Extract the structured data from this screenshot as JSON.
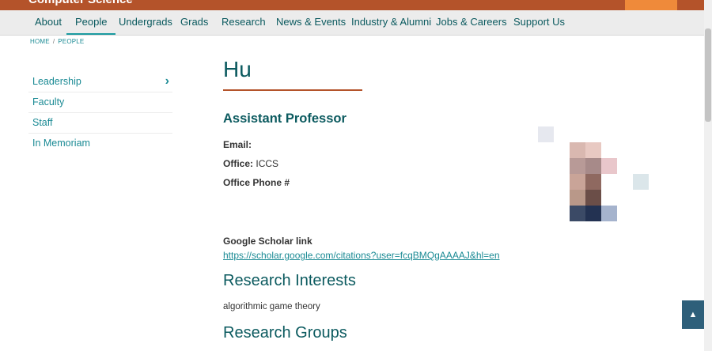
{
  "header": {
    "site_title": "Computer Science"
  },
  "nav": {
    "items": [
      {
        "label": "About"
      },
      {
        "label": "People"
      },
      {
        "label": "Undergrads"
      },
      {
        "label": "Grads"
      },
      {
        "label": "Research"
      },
      {
        "label": "News & Events"
      },
      {
        "label": "Industry & Alumni"
      },
      {
        "label": "Jobs & Careers"
      },
      {
        "label": "Support Us"
      }
    ],
    "active": "People"
  },
  "breadcrumb": {
    "home": "HOME",
    "sep": "/",
    "current": "PEOPLE"
  },
  "sidebar": {
    "items": [
      {
        "label": "Leadership"
      },
      {
        "label": "Faculty"
      },
      {
        "label": "Staff"
      },
      {
        "label": "In Memoriam"
      }
    ],
    "chevron": "›"
  },
  "profile": {
    "name": "Hu",
    "title": "Assistant Professor",
    "email_label": "Email:",
    "email_value": "",
    "office_label": "Office:",
    "office_value": "ICCS",
    "phone_label": "Office Phone #",
    "phone_value": "",
    "scholar_label": "Google Scholar link",
    "scholar_url": "https://scholar.google.com/citations?user=fcqBMQgAAAAJ&hl=en",
    "research_interests_heading": "Research Interests",
    "research_interests": "algorithmic game theory",
    "research_groups_heading": "Research Groups"
  },
  "icons": {
    "back_to_top": "chevron-up-icon"
  },
  "colors": {
    "brand": "#b4532a",
    "accent": "#1a8a94",
    "heading": "#0b5a5f",
    "nav_bg": "#ececec"
  }
}
